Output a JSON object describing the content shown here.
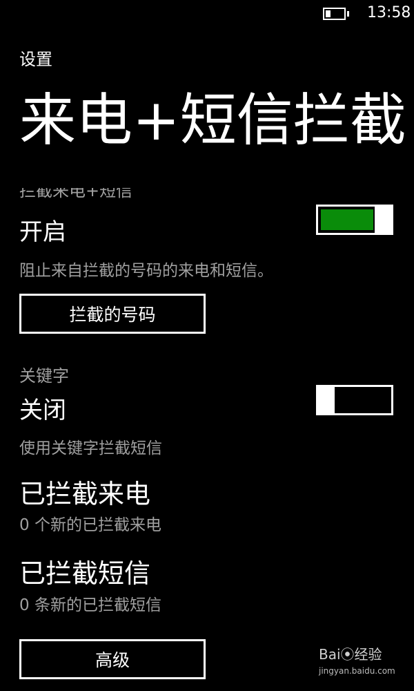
{
  "status": {
    "time": "13:58"
  },
  "header": {
    "app_title": "设置",
    "page_title": "来电+短信拦截"
  },
  "block_section": {
    "label": "拦截来电+短信",
    "state_text": "开启",
    "toggle_on": true,
    "accent": "#0a8c0a",
    "description": "阻止来自拦截的号码的来电和短信。",
    "button_label": "拦截的号码"
  },
  "keyword_section": {
    "label": "关键字",
    "state_text": "关闭",
    "toggle_on": false,
    "description": "使用关键字拦截短信"
  },
  "blocked_calls": {
    "title": "已拦截来电",
    "subtitle": "0 个新的已拦截来电"
  },
  "blocked_sms": {
    "title": "已拦截短信",
    "subtitle": "0 条新的已拦截短信"
  },
  "advanced_button": "高级",
  "watermark": {
    "text": "Bai⦿经验",
    "sub": "jingyan.baidu.com"
  }
}
